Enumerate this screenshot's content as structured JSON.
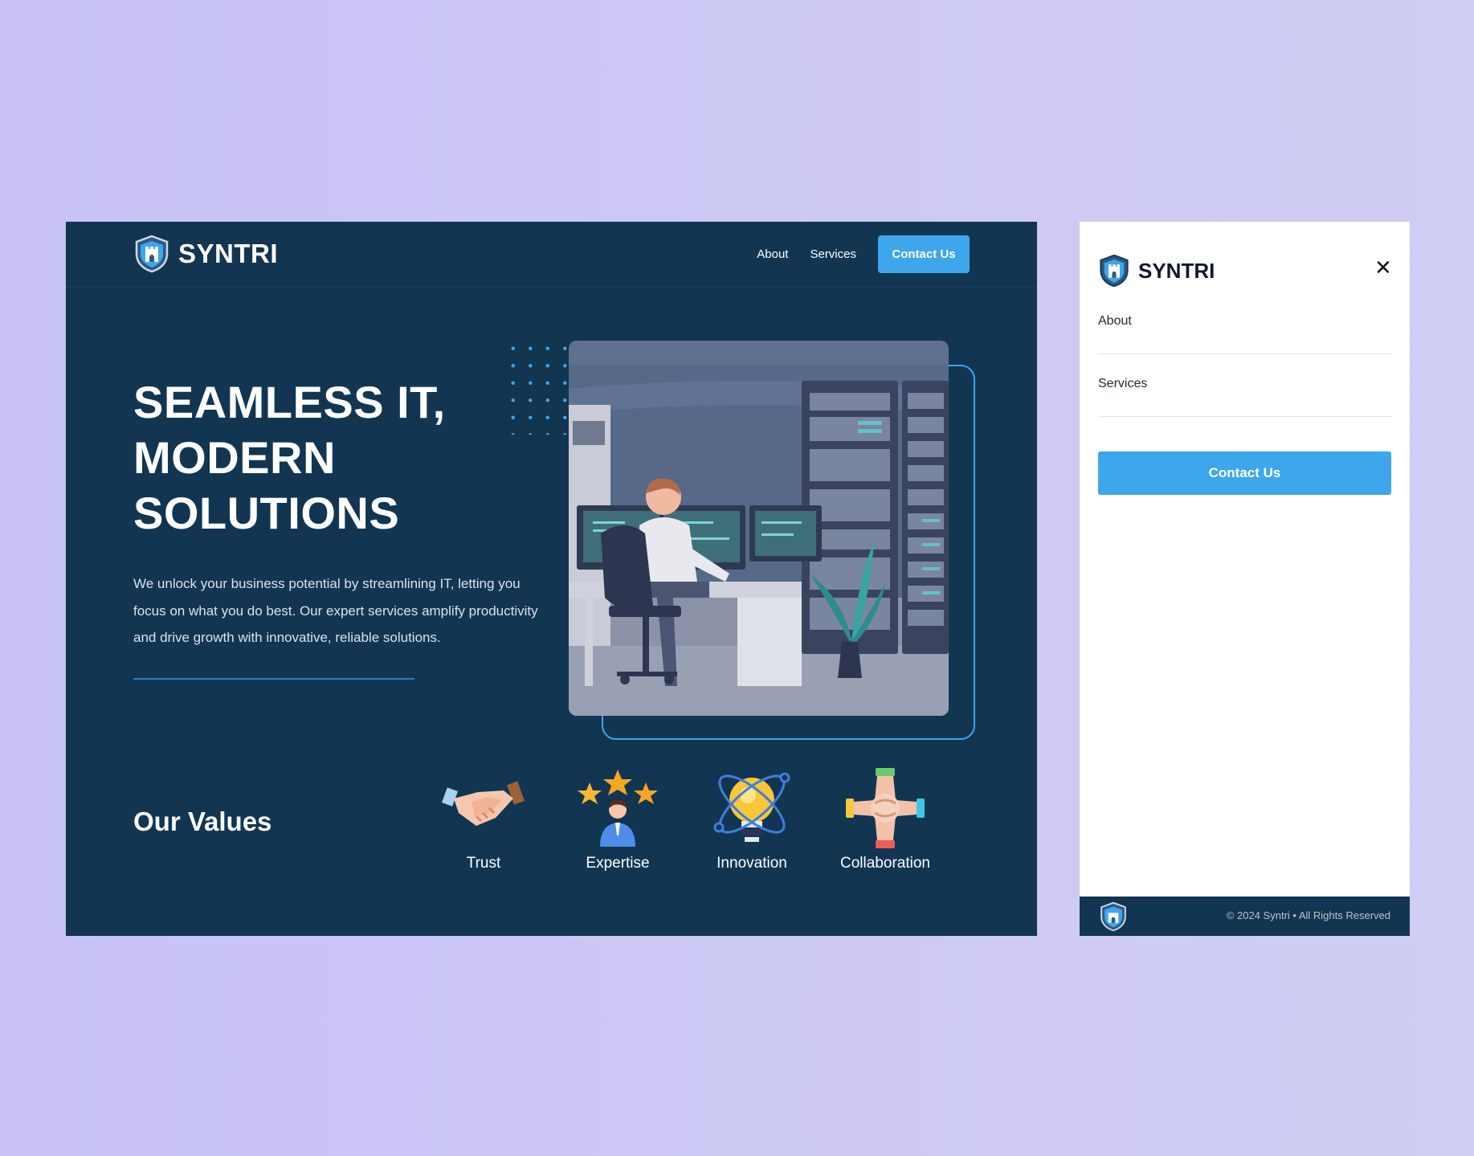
{
  "brand": {
    "name": "SYNTRI"
  },
  "desktop": {
    "nav": {
      "about": "About",
      "services": "Services",
      "contact": "Contact Us"
    },
    "hero": {
      "title": "SEAMLESS IT,\nMODERN\nSOLUTIONS",
      "body": "We unlock your business potential by streamlining IT, letting you focus on what you do best. Our expert services amplify productivity and drive growth with innovative, reliable solutions."
    },
    "values": {
      "title": "Our Values",
      "items": [
        {
          "label": "Trust",
          "icon": "handshake-icon"
        },
        {
          "label": "Expertise",
          "icon": "expert-stars-icon"
        },
        {
          "label": "Innovation",
          "icon": "lightbulb-icon"
        },
        {
          "label": "Collaboration",
          "icon": "joined-hands-icon"
        }
      ]
    }
  },
  "mobile_menu": {
    "items": [
      "About",
      "Services"
    ],
    "contact": "Contact Us",
    "footer": "© 2024 Syntri • All Rights Reserved"
  },
  "colors": {
    "page_bg": "#c8c2f7",
    "navy": "#123552",
    "accent": "#3ea6eb",
    "white": "#ffffff"
  }
}
